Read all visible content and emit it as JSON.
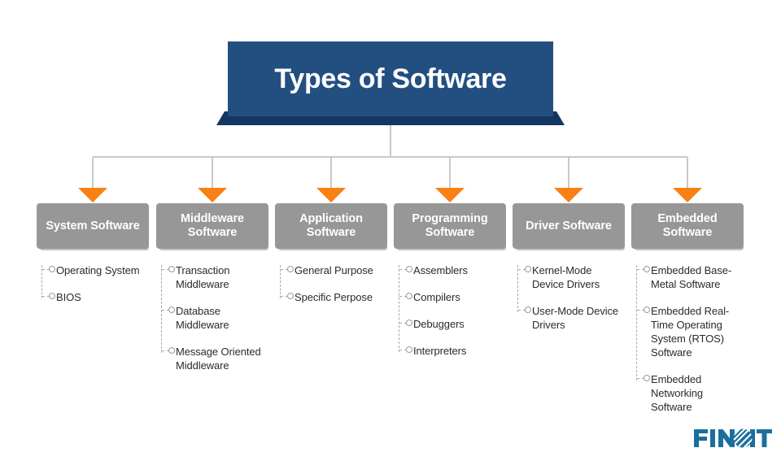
{
  "title": {
    "text": "Types of Software",
    "banner_color": "#234f80",
    "banner_tail_color": "#143664",
    "text_color": "#ffffff"
  },
  "theme": {
    "header_box_color": "#979797",
    "header_shadow_color": "#c3c3c3",
    "arrow_color": "#f98012",
    "connector_color": "#c9c9c9",
    "dashed_color": "#a8a8a8",
    "bullet_color": "#9a9a9a",
    "item_text_color": "#2b2b2b",
    "logo_color": "#1b6f9e"
  },
  "columns": [
    {
      "header": "System Software",
      "items": [
        "Operating System",
        "BIOS"
      ]
    },
    {
      "header": "Middleware Software",
      "items": [
        "Transaction Middleware",
        "Database Middleware",
        "Message Oriented Middleware"
      ]
    },
    {
      "header": "Application Software",
      "items": [
        "General Purpose",
        "Specific Perpose"
      ]
    },
    {
      "header": "Programming Software",
      "items": [
        "Assemblers",
        "Compilers",
        "Debuggers",
        "Interpreters"
      ]
    },
    {
      "header": "Driver Software",
      "items": [
        "Kernel-Mode Device Drivers",
        "User-Mode Device Drivers"
      ]
    },
    {
      "header": "Embedded Software",
      "items": [
        "Embedded Base-Metal Software",
        "Embedded Real-Time Operating System (RTOS) Software",
        "Embedded Networking Software"
      ]
    }
  ],
  "logo": {
    "text_left": "FIN",
    "text_right": "IT",
    "full_name": "FINOIT"
  }
}
